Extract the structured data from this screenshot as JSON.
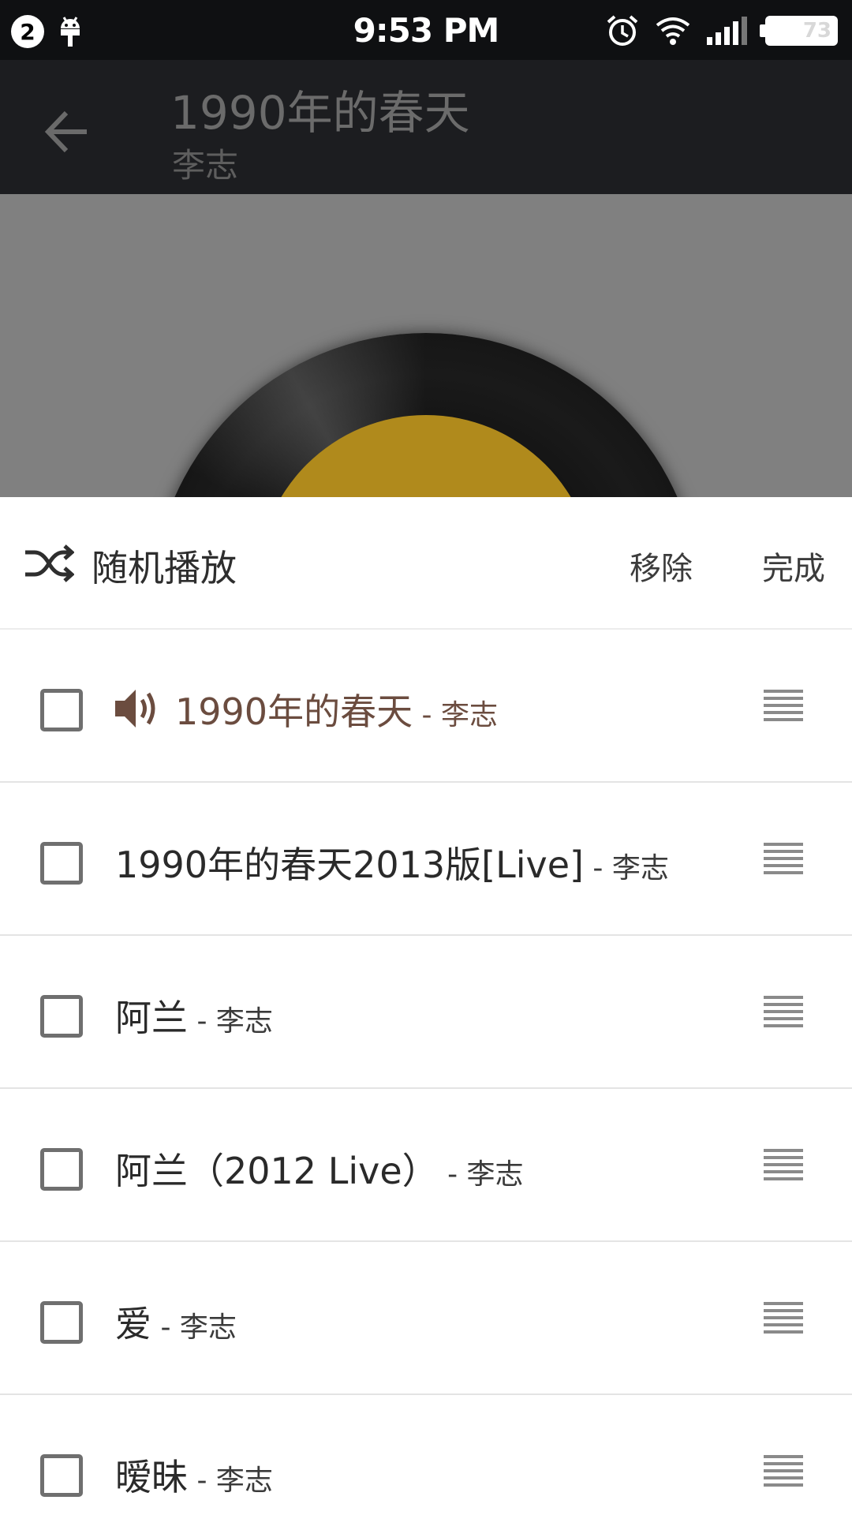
{
  "status_bar": {
    "notification_count": "2",
    "time": "9:53 PM",
    "battery": "73",
    "icons": [
      "android-icon",
      "alarm-icon",
      "wifi-icon",
      "signal-icon",
      "battery-icon"
    ]
  },
  "header": {
    "title": "1990年的春天",
    "subtitle": "李志"
  },
  "toolbar": {
    "shuffle_label": "随机播放",
    "remove_label": "移除",
    "done_label": "完成"
  },
  "colors": {
    "playing_accent": "#6b4c3f",
    "header_bg": "#1c1d20",
    "album_bg": "#808080",
    "record_label": "#b08a1c"
  },
  "songs": [
    {
      "title": "1990年的春天",
      "artist": " - 李志",
      "playing": true,
      "checked": false
    },
    {
      "title": "1990年的春天2013版[Live]",
      "artist": " - 李志",
      "playing": false,
      "checked": false
    },
    {
      "title": "阿兰",
      "artist": " - 李志",
      "playing": false,
      "checked": false
    },
    {
      "title": "阿兰（2012 Live）",
      "artist": " - 李志",
      "playing": false,
      "checked": false
    },
    {
      "title": "爱",
      "artist": " - 李志",
      "playing": false,
      "checked": false
    },
    {
      "title": "暧昧",
      "artist": " - 李志",
      "playing": false,
      "checked": false
    }
  ]
}
